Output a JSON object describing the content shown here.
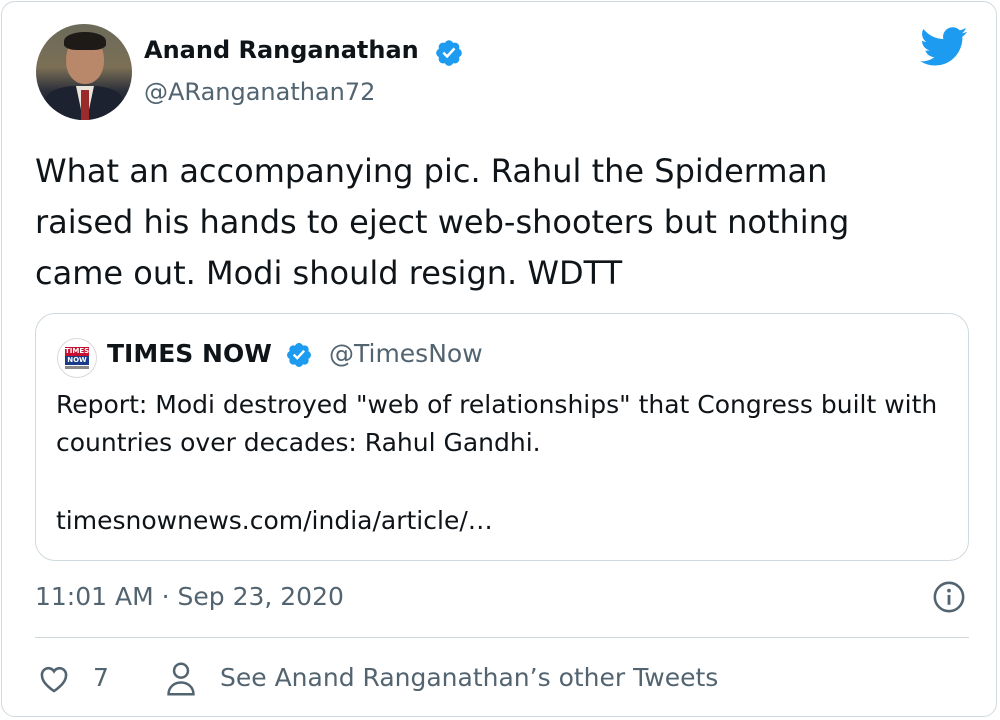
{
  "author": {
    "name": "Anand Ranganathan",
    "handle": "@ARanganathan72"
  },
  "tweet": {
    "text": "What an accompanying pic. Rahul the Spiderman\nraised his hands to eject web-shooters but nothing\ncame out. Modi should resign. WDTT"
  },
  "quoted": {
    "name": "TIMES NOW",
    "handle": "@TimesNow",
    "logo_text_top": "TIMES",
    "logo_text_bottom": "NOW",
    "text": "Report: Modi destroyed \"web of relationships\" that Congress built with countries over decades: Rahul Gandhi.",
    "link": "timesnownews.com/india/article/…"
  },
  "meta": {
    "timestamp": "11:01 AM · Sep 23, 2020"
  },
  "actions": {
    "like_count": "7",
    "other_tweets_label": "See Anand Ranganathan’s other Tweets"
  },
  "colors": {
    "brand": "#1d9bf0",
    "secondary_text": "#536471",
    "border": "#cfd9de"
  },
  "icons": [
    "twitter-bird-icon",
    "verified-badge-icon",
    "info-icon",
    "heart-icon",
    "person-icon"
  ]
}
